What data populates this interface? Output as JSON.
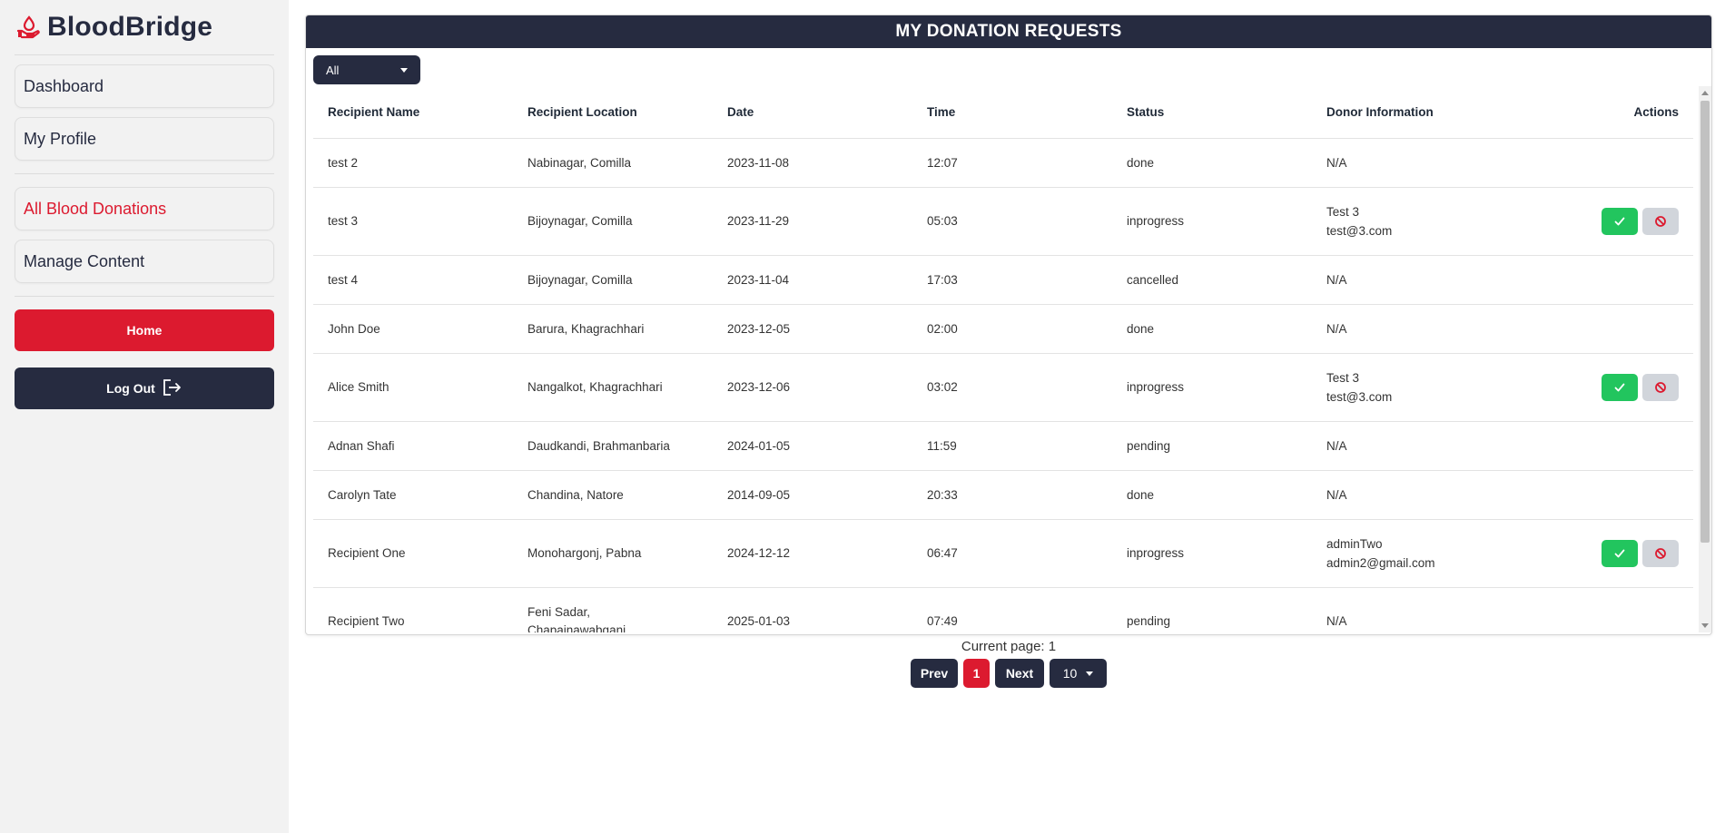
{
  "brand": {
    "name": "BloodBridge"
  },
  "sidebar": {
    "nav_primary": [
      {
        "label": "Dashboard"
      },
      {
        "label": "My Profile"
      }
    ],
    "nav_secondary": [
      {
        "label": "All Blood Donations",
        "active": true
      },
      {
        "label": "Manage Content"
      }
    ],
    "home_label": "Home",
    "logout_label": "Log Out"
  },
  "panel": {
    "title": "MY DONATION REQUESTS",
    "filter_value": "All"
  },
  "table": {
    "headers": {
      "name": "Recipient Name",
      "location": "Recipient Location",
      "date": "Date",
      "time": "Time",
      "status": "Status",
      "donor": "Donor Information",
      "actions": "Actions"
    },
    "rows": [
      {
        "name": "test 2",
        "location": "Nabinagar, Comilla",
        "date": "2023-11-08",
        "time": "12:07",
        "status": "done",
        "donor_name": "N/A",
        "donor_email": ""
      },
      {
        "name": "test 3",
        "location": "Bijoynagar, Comilla",
        "date": "2023-11-29",
        "time": "05:03",
        "status": "inprogress",
        "donor_name": "Test 3",
        "donor_email": "test@3.com"
      },
      {
        "name": "test 4",
        "location": "Bijoynagar, Comilla",
        "date": "2023-11-04",
        "time": "17:03",
        "status": "cancelled",
        "donor_name": "N/A",
        "donor_email": ""
      },
      {
        "name": "John Doe",
        "location": "Barura, Khagrachhari",
        "date": "2023-12-05",
        "time": "02:00",
        "status": "done",
        "donor_name": "N/A",
        "donor_email": ""
      },
      {
        "name": "Alice Smith",
        "location": "Nangalkot, Khagrachhari",
        "date": "2023-12-06",
        "time": "03:02",
        "status": "inprogress",
        "donor_name": "Test 3",
        "donor_email": "test@3.com"
      },
      {
        "name": "Adnan Shafi",
        "location": "Daudkandi, Brahmanbaria",
        "date": "2024-01-05",
        "time": "11:59",
        "status": "pending",
        "donor_name": "N/A",
        "donor_email": ""
      },
      {
        "name": "Carolyn Tate",
        "location": "Chandina, Natore",
        "date": "2014-09-05",
        "time": "20:33",
        "status": "done",
        "donor_name": "N/A",
        "donor_email": ""
      },
      {
        "name": "Recipient One",
        "location": "Monohargonj, Pabna",
        "date": "2024-12-12",
        "time": "06:47",
        "status": "inprogress",
        "donor_name": "adminTwo",
        "donor_email": "admin2@gmail.com"
      },
      {
        "name": "Recipient Two",
        "location": "Feni Sadar, Chapainawabganj",
        "date": "2025-01-03",
        "time": "07:49",
        "status": "pending",
        "donor_name": "N/A",
        "donor_email": ""
      }
    ]
  },
  "pagination": {
    "info": "Current page: 1",
    "prev_label": "Prev",
    "current": "1",
    "next_label": "Next",
    "page_size": "10"
  },
  "colors": {
    "brand_red": "#dc1a2f",
    "navy": "#262b40",
    "success": "#22c55e",
    "muted": "#d1d5db"
  }
}
